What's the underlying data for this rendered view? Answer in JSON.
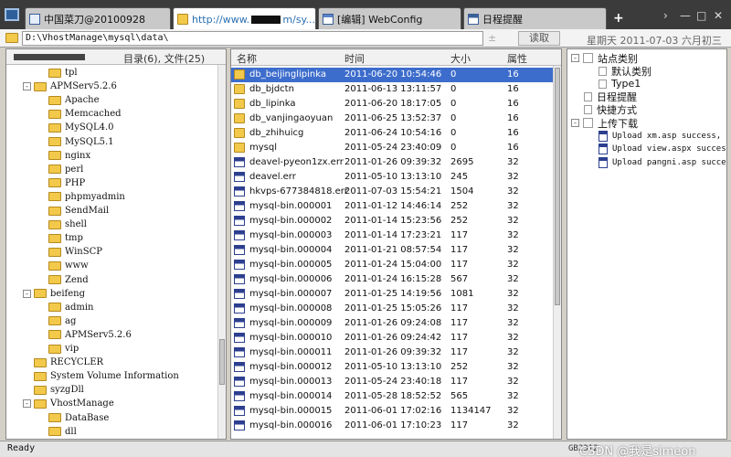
{
  "tabs": [
    {
      "label": "中国菜刀@20100928",
      "url_prefix": "",
      "url_suffix": ""
    },
    {
      "label": "",
      "url_prefix": "http://www.",
      "url_suffix": "m/sy..."
    },
    {
      "label": "[编辑] WebConfig",
      "url_prefix": "",
      "url_suffix": ""
    },
    {
      "label": "日程提醒",
      "url_prefix": "",
      "url_suffix": ""
    }
  ],
  "window_controls": {
    "new_tab": "+",
    "next": "›",
    "minimize": "—",
    "maximize": "□",
    "close": "✕"
  },
  "address": {
    "path": "D:\\VhostManage\\mysql\\data\\",
    "plus": "±",
    "read_button": "读取",
    "date_label": "星期天 2011-07-03 六月初三"
  },
  "tree": {
    "header_count": "目录(6), 文件(25)",
    "nodes": [
      {
        "label": "tpl",
        "level": 2,
        "expand": ""
      },
      {
        "label": "APMServ5.2.6",
        "level": 1,
        "expand": "-"
      },
      {
        "label": "Apache",
        "level": 2,
        "expand": ""
      },
      {
        "label": "Memcached",
        "level": 2,
        "expand": ""
      },
      {
        "label": "MySQL4.0",
        "level": 2,
        "expand": ""
      },
      {
        "label": "MySQL5.1",
        "level": 2,
        "expand": ""
      },
      {
        "label": "nginx",
        "level": 2,
        "expand": ""
      },
      {
        "label": "perl",
        "level": 2,
        "expand": ""
      },
      {
        "label": "PHP",
        "level": 2,
        "expand": ""
      },
      {
        "label": "phpmyadmin",
        "level": 2,
        "expand": ""
      },
      {
        "label": "SendMail",
        "level": 2,
        "expand": ""
      },
      {
        "label": "shell",
        "level": 2,
        "expand": ""
      },
      {
        "label": "tmp",
        "level": 2,
        "expand": ""
      },
      {
        "label": "WinSCP",
        "level": 2,
        "expand": ""
      },
      {
        "label": "www",
        "level": 2,
        "expand": ""
      },
      {
        "label": "Zend",
        "level": 2,
        "expand": ""
      },
      {
        "label": "beifeng",
        "level": 1,
        "expand": "-"
      },
      {
        "label": "admin",
        "level": 2,
        "expand": ""
      },
      {
        "label": "ag",
        "level": 2,
        "expand": ""
      },
      {
        "label": "APMServ5.2.6",
        "level": 2,
        "expand": ""
      },
      {
        "label": "vip",
        "level": 2,
        "expand": ""
      },
      {
        "label": "RECYCLER",
        "level": 1,
        "expand": ""
      },
      {
        "label": "System Volume Information",
        "level": 1,
        "expand": ""
      },
      {
        "label": "syzgDll",
        "level": 1,
        "expand": ""
      },
      {
        "label": "VhostManage",
        "level": 1,
        "expand": "-"
      },
      {
        "label": "DataBase",
        "level": 2,
        "expand": ""
      },
      {
        "label": "dll",
        "level": 2,
        "expand": ""
      }
    ]
  },
  "files": {
    "columns": [
      "名称",
      "时间",
      "大小",
      "属性"
    ],
    "rows": [
      {
        "name": "db_beijinglipinka",
        "time": "2011-06-20 10:54:46",
        "size": "0",
        "attr": "16",
        "type": "folder"
      },
      {
        "name": "db_bjdctn",
        "time": "2011-06-13 13:11:57",
        "size": "0",
        "attr": "16",
        "type": "folder"
      },
      {
        "name": "db_lipinka",
        "time": "2011-06-20 18:17:05",
        "size": "0",
        "attr": "16",
        "type": "folder"
      },
      {
        "name": "db_vanjingaoyuan",
        "time": "2011-06-25 13:52:37",
        "size": "0",
        "attr": "16",
        "type": "folder"
      },
      {
        "name": "db_zhihuicg",
        "time": "2011-06-24 10:54:16",
        "size": "0",
        "attr": "16",
        "type": "folder"
      },
      {
        "name": "mysql",
        "time": "2011-05-24 23:40:09",
        "size": "0",
        "attr": "16",
        "type": "folder"
      },
      {
        "name": "deavel-pyeon1zx.err",
        "time": "2011-01-26 09:39:32",
        "size": "2695",
        "attr": "32",
        "type": "file"
      },
      {
        "name": "deavel.err",
        "time": "2011-05-10 13:13:10",
        "size": "245",
        "attr": "32",
        "type": "file"
      },
      {
        "name": "hkvps-677384818.err",
        "time": "2011-07-03 15:54:21",
        "size": "1504",
        "attr": "32",
        "type": "file"
      },
      {
        "name": "mysql-bin.000001",
        "time": "2011-01-12 14:46:14",
        "size": "252",
        "attr": "32",
        "type": "file"
      },
      {
        "name": "mysql-bin.000002",
        "time": "2011-01-14 15:23:56",
        "size": "252",
        "attr": "32",
        "type": "file"
      },
      {
        "name": "mysql-bin.000003",
        "time": "2011-01-14 17:23:21",
        "size": "117",
        "attr": "32",
        "type": "file"
      },
      {
        "name": "mysql-bin.000004",
        "time": "2011-01-21 08:57:54",
        "size": "117",
        "attr": "32",
        "type": "file"
      },
      {
        "name": "mysql-bin.000005",
        "time": "2011-01-24 15:04:00",
        "size": "117",
        "attr": "32",
        "type": "file"
      },
      {
        "name": "mysql-bin.000006",
        "time": "2011-01-24 16:15:28",
        "size": "567",
        "attr": "32",
        "type": "file"
      },
      {
        "name": "mysql-bin.000007",
        "time": "2011-01-25 14:19:56",
        "size": "1081",
        "attr": "32",
        "type": "file"
      },
      {
        "name": "mysql-bin.000008",
        "time": "2011-01-25 15:05:26",
        "size": "117",
        "attr": "32",
        "type": "file"
      },
      {
        "name": "mysql-bin.000009",
        "time": "2011-01-26 09:24:08",
        "size": "117",
        "attr": "32",
        "type": "file"
      },
      {
        "name": "mysql-bin.000010",
        "time": "2011-01-26 09:24:42",
        "size": "117",
        "attr": "32",
        "type": "file"
      },
      {
        "name": "mysql-bin.000011",
        "time": "2011-01-26 09:39:32",
        "size": "117",
        "attr": "32",
        "type": "file"
      },
      {
        "name": "mysql-bin.000012",
        "time": "2011-05-10 13:13:10",
        "size": "252",
        "attr": "32",
        "type": "file"
      },
      {
        "name": "mysql-bin.000013",
        "time": "2011-05-24 23:40:18",
        "size": "117",
        "attr": "32",
        "type": "file"
      },
      {
        "name": "mysql-bin.000014",
        "time": "2011-05-28 18:52:52",
        "size": "565",
        "attr": "32",
        "type": "file"
      },
      {
        "name": "mysql-bin.000015",
        "time": "2011-06-01 17:02:16",
        "size": "1134147",
        "attr": "32",
        "type": "file"
      },
      {
        "name": "mysql-bin.000016",
        "time": "2011-06-01 17:10:23",
        "size": "117",
        "attr": "32",
        "type": "file"
      }
    ]
  },
  "right_tree": {
    "nodes": [
      {
        "label": "站点类别",
        "kind": "group",
        "expand": "-"
      },
      {
        "label": "默认类别",
        "kind": "leaf"
      },
      {
        "label": "Type1",
        "kind": "leaf"
      },
      {
        "label": "日程提醒",
        "kind": "item"
      },
      {
        "label": "快捷方式",
        "kind": "item"
      },
      {
        "label": "上传下载",
        "kind": "group",
        "expand": "-"
      },
      {
        "label": "Upload xm.asp success,",
        "kind": "log"
      },
      {
        "label": "Upload view.aspx succes",
        "kind": "log"
      },
      {
        "label": "Upload pangni.asp succe",
        "kind": "log"
      }
    ]
  },
  "status": {
    "ready": "Ready",
    "encoding": "GB2312",
    "watermark": "CSDN @我是simeon"
  }
}
